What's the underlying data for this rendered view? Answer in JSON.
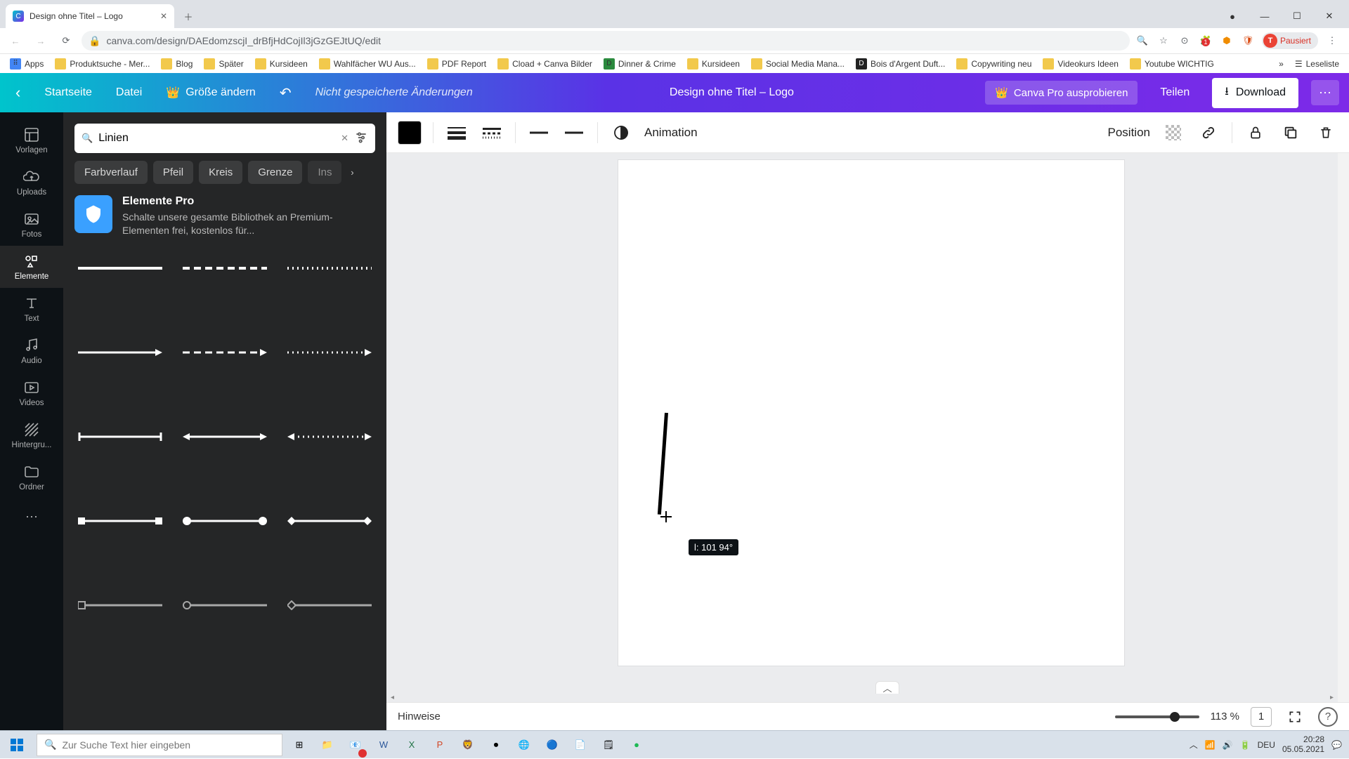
{
  "browser": {
    "tab_title": "Design ohne Titel – Logo",
    "url": "canva.com/design/DAEdomzscjI_drBfjHdCojIl3jGzGEJtUQ/edit",
    "profile_status": "Pausiert",
    "bookmarks": [
      "Apps",
      "Produktsuche - Mer...",
      "Blog",
      "Später",
      "Kursideen",
      "Wahlfächer WU Aus...",
      "PDF Report",
      "Cload + Canva Bilder",
      "Dinner & Crime",
      "Kursideen",
      "Social Media Mana...",
      "Bois d'Argent Duft...",
      "Copywriting neu",
      "Videokurs Ideen",
      "Youtube WICHTIG"
    ],
    "reading_list": "Leseliste"
  },
  "header": {
    "home": "Startseite",
    "file": "Datei",
    "resize": "Größe ändern",
    "save_status": "Nicht gespeicherte Änderungen",
    "title": "Design ohne Titel – Logo",
    "pro": "Canva Pro ausprobieren",
    "share": "Teilen",
    "download": "Download"
  },
  "rail": {
    "items": [
      "Vorlagen",
      "Uploads",
      "Fotos",
      "Elemente",
      "Text",
      "Audio",
      "Videos",
      "Hintergru...",
      "Ordner"
    ],
    "active_index": 3
  },
  "panel": {
    "search_value": "Linien",
    "chips": [
      "Farbverlauf",
      "Pfeil",
      "Kreis",
      "Grenze",
      "Ins"
    ],
    "promo_title": "Elemente Pro",
    "promo_desc": "Schalte unsere gesamte Bibliothek an Premium-Elementen frei, kostenlos für..."
  },
  "toolbar": {
    "animation": "Animation",
    "position": "Position"
  },
  "canvas": {
    "tooltip": "l: 101 94°"
  },
  "footer": {
    "notes": "Hinweise",
    "zoom": "113 %",
    "page": "1"
  },
  "taskbar": {
    "search_placeholder": "Zur Suche Text hier eingeben",
    "lang": "DEU",
    "time": "20:28",
    "date": "05.05.2021"
  }
}
